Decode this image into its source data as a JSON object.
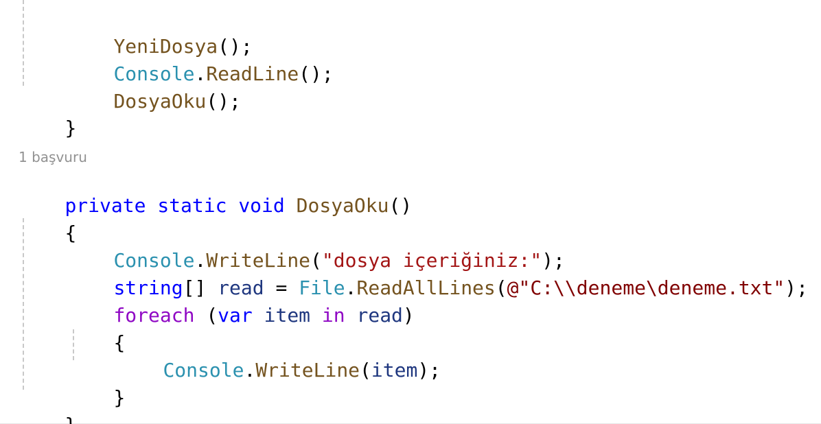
{
  "code_lens": {
    "references": "1 başvuru"
  },
  "tokens": {
    "yeni_dosya": "YeniDosya",
    "console": "Console",
    "read_line": "ReadLine",
    "dosya_oku": "DosyaOku",
    "call_end": "();",
    "call_open": "(",
    "close_paren": ")",
    "close_call": ");",
    "dot": ".",
    "brace_open": "{",
    "brace_close": "}",
    "private": "private",
    "static": "static",
    "void": "void",
    "parens": "()",
    "write_line": "WriteLine",
    "str_dosya": "\"dosya içeriğiniz:\"",
    "string": "string",
    "brackets": "[]",
    "read": "read",
    "assign": "=",
    "file": "File",
    "read_all_lines": "ReadAllLines",
    "verbatim_prefix": "@\"",
    "path_part1": "C:",
    "escape1": "\\\\",
    "path_part2": "deneme",
    "escape2": "\\d",
    "path_part3": "eneme.txt",
    "quote": "\"",
    "foreach": "foreach",
    "var": "var",
    "item": "item",
    "in": "in"
  }
}
